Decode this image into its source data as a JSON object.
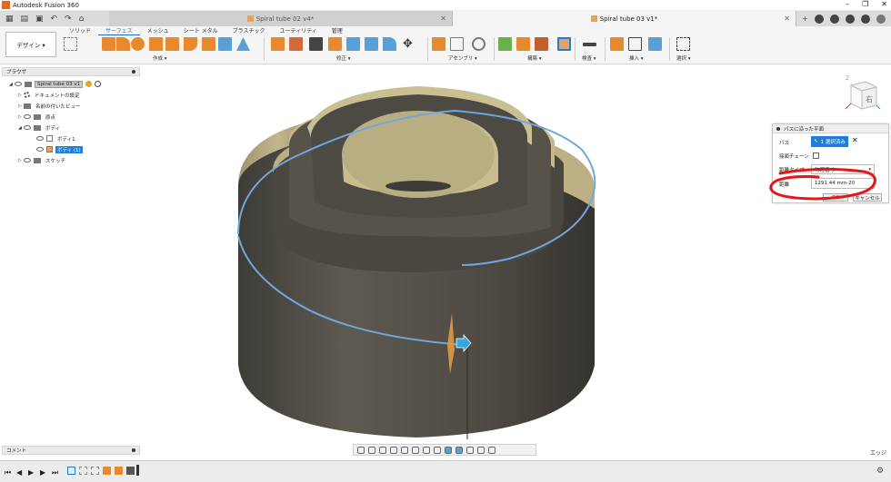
{
  "window": {
    "title": "Autodesk Fusion 360",
    "buttons": [
      "–",
      "❐",
      "✕"
    ]
  },
  "tabs": [
    {
      "label": "Spiral tube 02 v4*",
      "active": false
    },
    {
      "label": "Spiral tube 03 v1*",
      "active": true
    }
  ],
  "workspace": {
    "label": "デザイン ▾"
  },
  "ribbon_tabs": [
    "ソリッド",
    "サーフェス",
    "メッシュ",
    "シート メタル",
    "プラスチック",
    "ユーティリティ",
    "管理"
  ],
  "ribbon_active_tab": "サーフェス",
  "ribbon_groups": [
    "作成 ▾",
    "修正 ▾",
    "アセンブリ ▾",
    "構築 ▾",
    "検査 ▾",
    "挿入 ▾",
    "選択 ▾"
  ],
  "browser": {
    "title": "ブラウザ",
    "root": "Spiral tube 03 v1",
    "nodes": [
      "ドキュメントの設定",
      "名前の付いたビュー",
      "原点",
      "ボディ",
      "ボディ1",
      "ボディ (1)",
      "スケッチ"
    ]
  },
  "viewcube": {
    "face_label": "右",
    "axis": "Z"
  },
  "panel": {
    "title": "パスに沿った平面",
    "path_label": "パス",
    "path_button": "1 選択済み",
    "chain_label": "接面チェーン",
    "dist_type_label": "距離タイプ",
    "dist_type_value": "物理値寸",
    "distance_label": "距離",
    "distance_value": "1291.44 mm-20",
    "ok": "OK",
    "cancel": "キャンセル"
  },
  "comments": {
    "label": "コメント"
  },
  "status": {
    "right": "エッジ"
  },
  "colors": {
    "accent": "#1e7ed8",
    "annotation": "#e8141a",
    "shell": "#545048",
    "shell_inner": "#b2a77e",
    "path": "#6fa8dc"
  }
}
